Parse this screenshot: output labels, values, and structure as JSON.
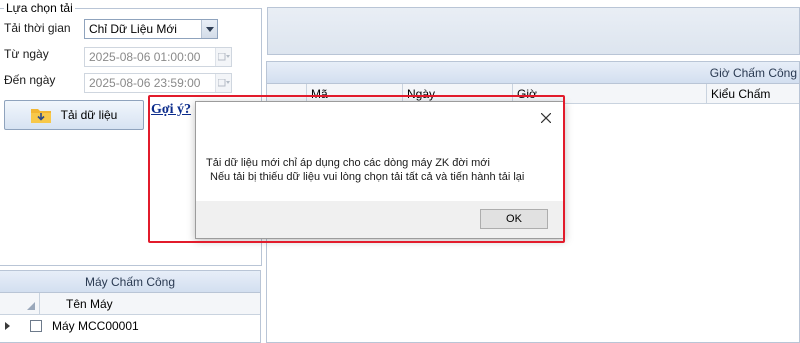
{
  "left": {
    "group_title": "Lựa chọn tải",
    "time_label": "Tải thời gian",
    "time_value": "Chỉ Dữ Liệu Mới",
    "from_label": "Từ ngày",
    "from_value": "2025-08-06 01:00:00",
    "to_label": "Đến ngày",
    "to_value": "2025-08-06 23:59:00",
    "load_button": "Tải dữ liệu",
    "hint_link": "Gợi ý?"
  },
  "machines": {
    "title": "Máy Chấm Công",
    "column": "Tên Máy",
    "rows": [
      "Máy MCC00001"
    ]
  },
  "grid": {
    "title": "Giờ Chấm Công",
    "columns": [
      "Mã",
      "Ngày",
      "Giờ",
      "Kiểu Chấm"
    ]
  },
  "dialog": {
    "line1": "Tải dữ liệu mới chỉ áp dụng cho các dòng máy ZK đời mới",
    "line2": "Nếu tải bị thiếu dữ liệu vui lòng chọn tải tất cả và tiến hành tải lại",
    "ok": "OK",
    "close_icon": "close-icon"
  },
  "colors": {
    "highlight": "#e21b2b",
    "link": "#0b2c8c"
  }
}
